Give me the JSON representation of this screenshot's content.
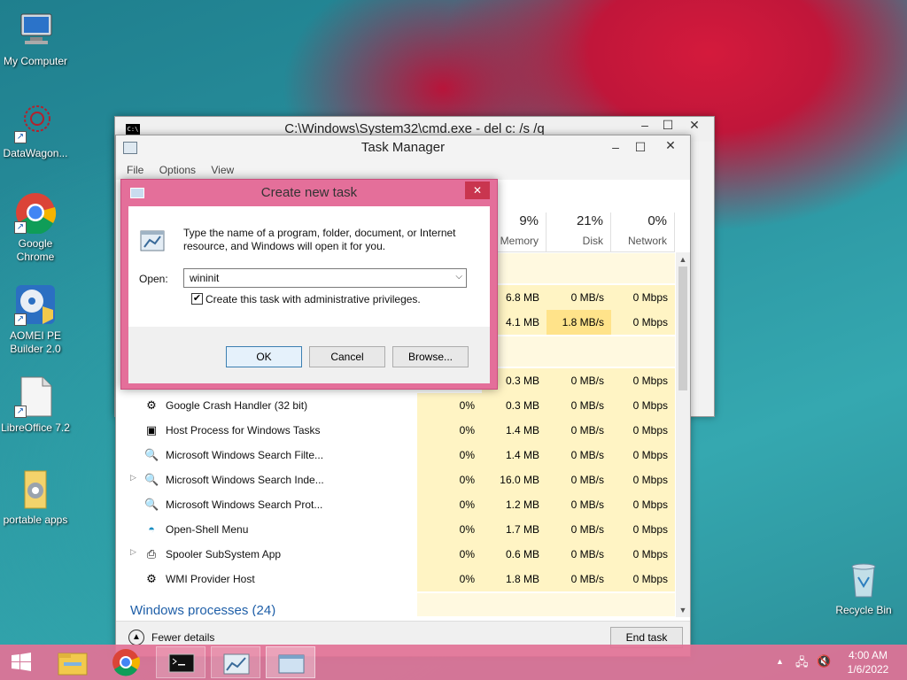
{
  "desktop": {
    "icons": [
      {
        "label": "My Computer",
        "icon": "computer-icon"
      },
      {
        "label": "DataWagon...",
        "icon": "datawagon-icon"
      },
      {
        "label": "Google Chrome",
        "icon": "chrome-icon"
      },
      {
        "label": "AOMEI PE Builder 2.0",
        "icon": "aomei-icon"
      },
      {
        "label": "LibreOffice 7.2",
        "icon": "libreoffice-icon"
      },
      {
        "label": "portable apps",
        "icon": "folder-icon"
      },
      {
        "label": "Recycle Bin",
        "icon": "recycle-bin-icon"
      }
    ]
  },
  "cmd_window": {
    "title": "C:\\Windows\\System32\\cmd.exe - del  c: /s /q"
  },
  "task_manager": {
    "title": "Task Manager",
    "menu": [
      "File",
      "Options",
      "View"
    ],
    "columns": [
      {
        "pct": "9%",
        "label": "Memory"
      },
      {
        "pct": "21%",
        "label": "Disk"
      },
      {
        "pct": "0%",
        "label": "Network"
      }
    ],
    "partial_rows": [
      {
        "memory": "6.8 MB",
        "disk": "0 MB/s",
        "network": "0 Mbps"
      },
      {
        "memory": "4.1 MB",
        "disk": "1.8 MB/s",
        "network": "0 Mbps"
      },
      {
        "memory": "0.3 MB",
        "disk": "0 MB/s",
        "network": "0 Mbps"
      }
    ],
    "rows": [
      {
        "name": "Google Crash Handler (32 bit)",
        "icon": "crash-handler-icon",
        "cpu": "0%",
        "memory": "0.3 MB",
        "disk": "0 MB/s",
        "network": "0 Mbps",
        "expand": false
      },
      {
        "name": "Host Process for Windows Tasks",
        "icon": "host-process-icon",
        "cpu": "0%",
        "memory": "1.4 MB",
        "disk": "0 MB/s",
        "network": "0 Mbps",
        "expand": false
      },
      {
        "name": "Microsoft Windows Search Filte...",
        "icon": "search-filter-icon",
        "cpu": "0%",
        "memory": "1.4 MB",
        "disk": "0 MB/s",
        "network": "0 Mbps",
        "expand": false
      },
      {
        "name": "Microsoft Windows Search Inde...",
        "icon": "search-indexer-icon",
        "cpu": "0%",
        "memory": "16.0 MB",
        "disk": "0 MB/s",
        "network": "0 Mbps",
        "expand": true
      },
      {
        "name": "Microsoft Windows Search Prot...",
        "icon": "search-protocol-icon",
        "cpu": "0%",
        "memory": "1.2 MB",
        "disk": "0 MB/s",
        "network": "0 Mbps",
        "expand": false
      },
      {
        "name": "Open-Shell Menu",
        "icon": "open-shell-icon",
        "cpu": "0%",
        "memory": "1.7 MB",
        "disk": "0 MB/s",
        "network": "0 Mbps",
        "expand": false
      },
      {
        "name": "Spooler SubSystem App",
        "icon": "printer-icon",
        "cpu": "0%",
        "memory": "0.6 MB",
        "disk": "0 MB/s",
        "network": "0 Mbps",
        "expand": true
      },
      {
        "name": "WMI Provider Host",
        "icon": "wmi-icon",
        "cpu": "0%",
        "memory": "1.8 MB",
        "disk": "0 MB/s",
        "network": "0 Mbps",
        "expand": false
      }
    ],
    "section_label": "Windows processes (24)",
    "fewer_details": "Fewer details",
    "end_task": "End task"
  },
  "dialog": {
    "title": "Create new task",
    "description": "Type the name of a program, folder, document, or Internet resource, and Windows will open it for you.",
    "open_label": "Open:",
    "open_value": "wininit",
    "admin_checkbox_label": "Create this task with administrative privileges.",
    "admin_checked": true,
    "ok": "OK",
    "cancel": "Cancel",
    "browse": "Browse..."
  },
  "taskbar": {
    "items": [
      "start-icon",
      "file-explorer-icon",
      "chrome-icon",
      "cmd-icon",
      "task-manager-icon",
      "run-dialog-icon"
    ],
    "time": "4:00 AM",
    "date": "1/6/2022"
  }
}
